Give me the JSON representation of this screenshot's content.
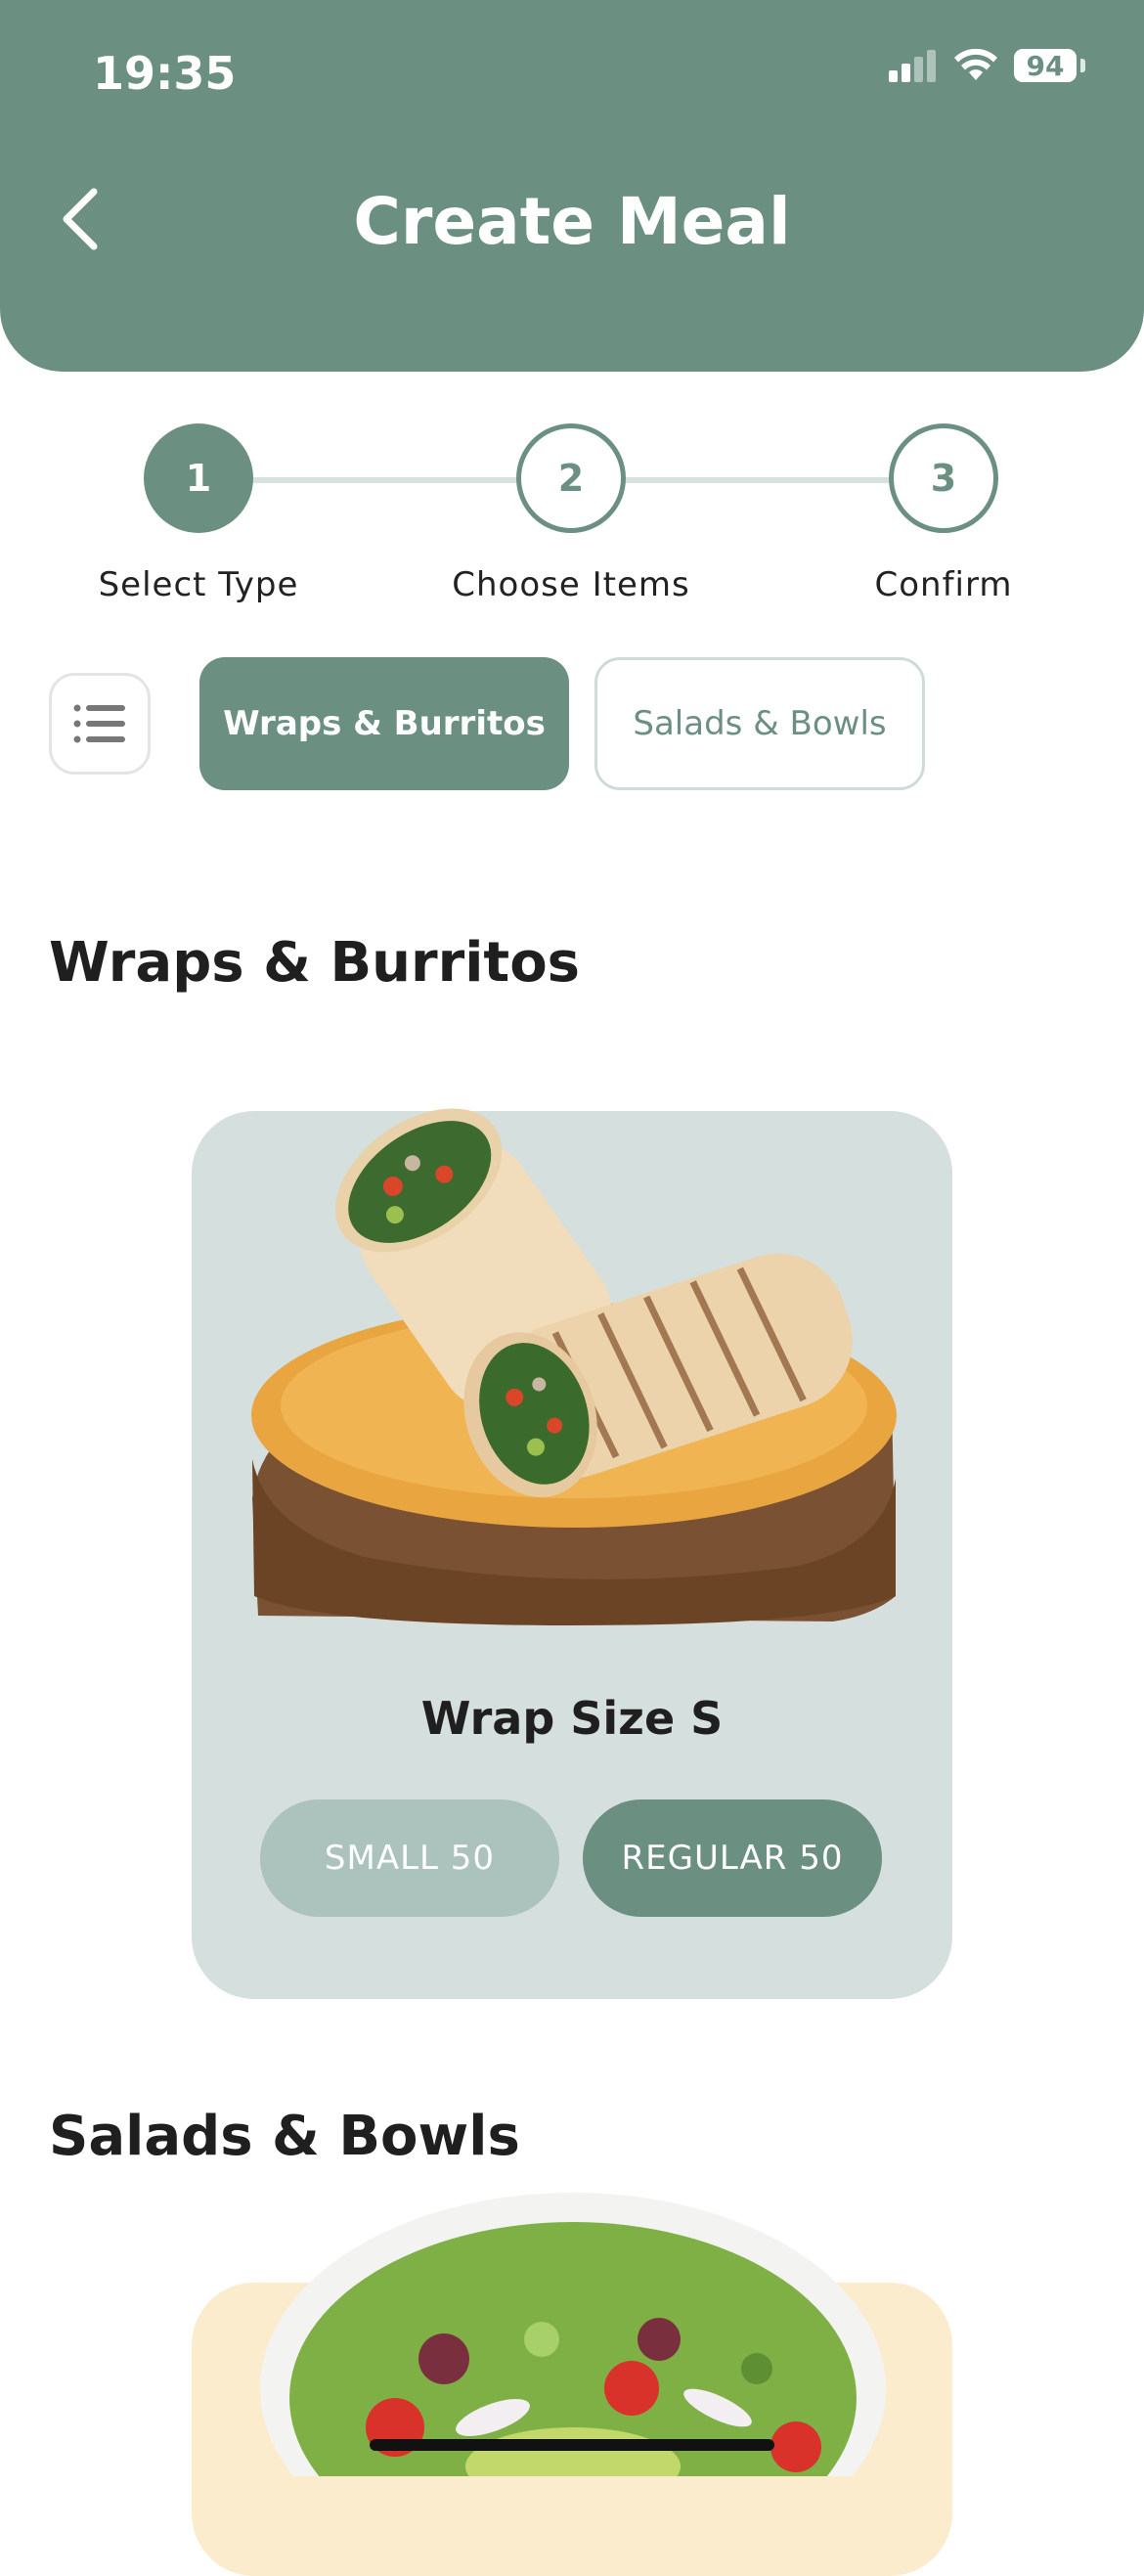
{
  "status_bar": {
    "time": "19:35",
    "battery": "94"
  },
  "header": {
    "title": "Create Meal"
  },
  "stepper": {
    "steps": [
      {
        "number": "1",
        "label": "Select Type",
        "state": "active"
      },
      {
        "number": "2",
        "label": "Choose Items",
        "state": "inactive"
      },
      {
        "number": "3",
        "label": "Confirm",
        "state": "inactive"
      }
    ]
  },
  "filters": {
    "chips": [
      {
        "label": "Wraps & Burritos",
        "selected": true
      },
      {
        "label": "Salads & Bowls",
        "selected": false
      }
    ]
  },
  "sections": [
    {
      "title": "Wraps & Burritos",
      "product": {
        "name": "Wrap Size S",
        "options": [
          {
            "label": "SMALL 50",
            "selected": false
          },
          {
            "label": "REGULAR 50",
            "selected": true
          }
        ]
      }
    },
    {
      "title": "Salads & Bowls"
    }
  ],
  "colors": {
    "accent": "#6b9081",
    "card_bg": "#d5dfdd",
    "chip_border": "#cfdcd6",
    "muted_button": "#acc3bd",
    "salad_card": "#fbeccd"
  }
}
